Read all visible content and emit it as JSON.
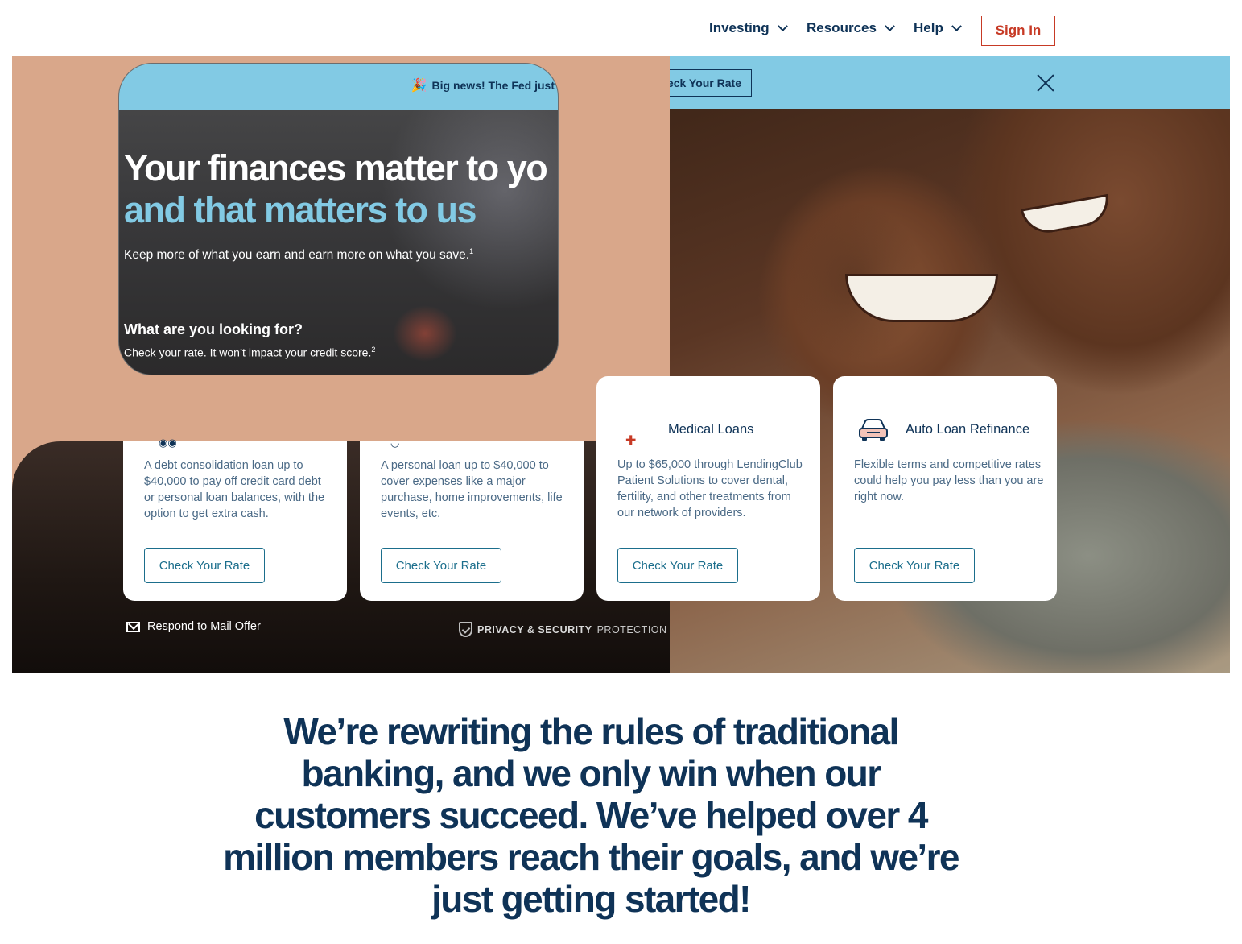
{
  "nav": {
    "items": [
      {
        "label": "Investing"
      },
      {
        "label": "Resources"
      },
      {
        "label": "Help"
      }
    ],
    "sign_in": "Sign In"
  },
  "banner": {
    "news_text": "Big news! The Fed just",
    "button_label": "eck Your Rate",
    "close_icon": "close-icon"
  },
  "hero": {
    "title_line1": "Your finances matter to yo",
    "title_line2": "and that matters to us",
    "subtitle": "Keep more of what you earn and earn more on what you save.",
    "subtitle_sup": "1",
    "question": "What are you looking for?",
    "question_sub": "Check your rate. It won’t impact your credit score.",
    "question_sup": "2",
    "respond_mail": "Respond to Mail Offer",
    "privacy_bold": "PRIVACY & SECURITY",
    "privacy_rest": "PROTECTION"
  },
  "cards": [
    {
      "title": "",
      "description": "A debt consolidation loan up to $40,000 to pay off credit card debt or personal loan balances, with the option to get extra cash.",
      "button": "Check Your Rate"
    },
    {
      "title": "",
      "description": "A personal loan up to $40,000 to cover expenses like a major purchase, home improvements, life events, etc.",
      "button": "Check Your Rate"
    },
    {
      "title": "Medical Loans",
      "description": "Up to $65,000 through LendingClub Patient Solutions to cover dental, fertility, and other treatments from our network of providers.",
      "button": "Check Your Rate"
    },
    {
      "title": "Auto Loan Refinance",
      "description": "Flexible terms and competitive rates could help you pay less than you are right now.",
      "button": "Check Your Rate"
    }
  ],
  "statement": "We’re rewriting the rules of traditional banking, and we only win when our customers succeed. We’ve helped over 4 million members reach their goals, and we’re just getting started!",
  "colors": {
    "navy": "#0f3357",
    "sky": "#82cae4",
    "teal_button": "#1b6e8c",
    "sign_in_red": "#c73a25"
  }
}
